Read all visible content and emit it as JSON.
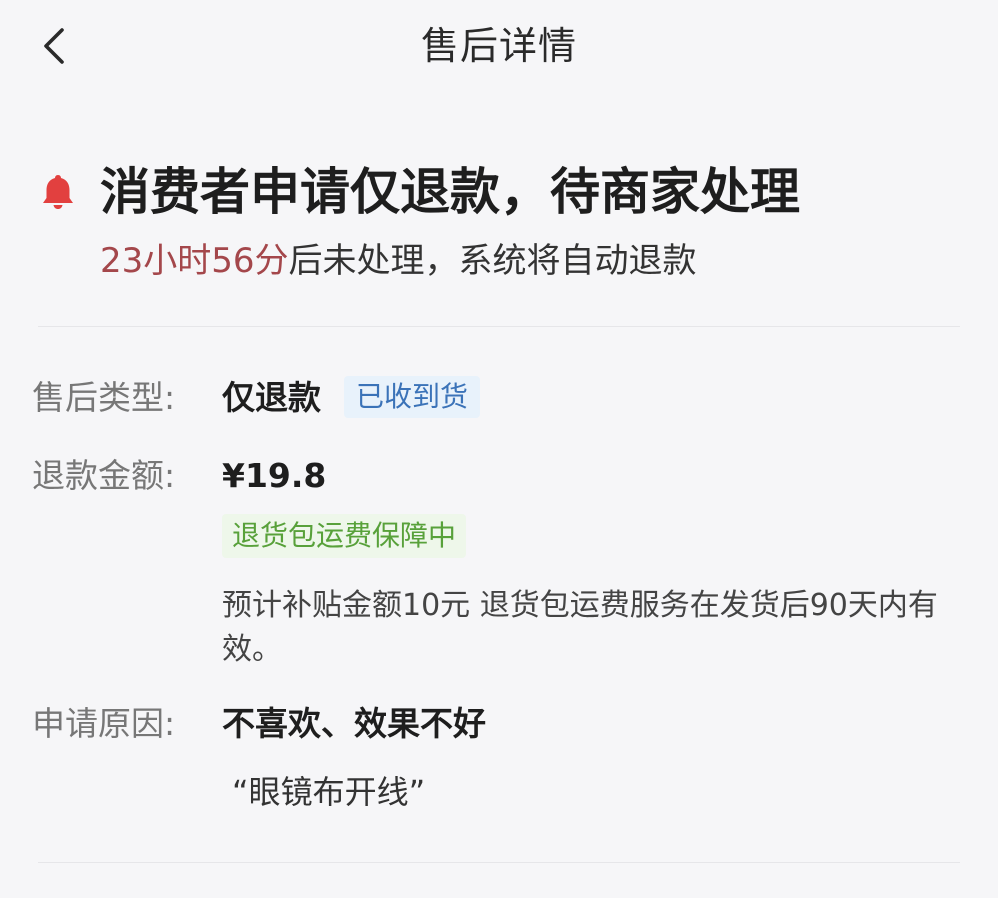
{
  "header": {
    "title": "售后详情",
    "back_icon": "chevron-left-icon"
  },
  "status": {
    "icon": "bell-icon",
    "title": "消费者申请仅退款，待商家处理",
    "countdown": "23小时56分",
    "countdown_suffix": "后未处理，系统将自动退款"
  },
  "details": {
    "type_label": "售后类型:",
    "type_value": "仅退款",
    "type_tag": "已收到货",
    "amount_label": "退款金额:",
    "amount_value": "¥19.8",
    "amount_tag": "退货包运费保障中",
    "amount_note": "预计补贴金额10元 退货包运费服务在发货后90天内有效。",
    "reason_label": "申请原因:",
    "reason_value": "不喜欢、效果不好",
    "reason_quote": "“眼镜布开线”"
  },
  "colors": {
    "countdown": "#a4474b",
    "bell": "#e2403f",
    "tag_blue_bg": "#e8f2fb",
    "tag_blue_text": "#3b73b8",
    "tag_green_bg": "#eef7ea",
    "tag_green_text": "#58a13a"
  }
}
